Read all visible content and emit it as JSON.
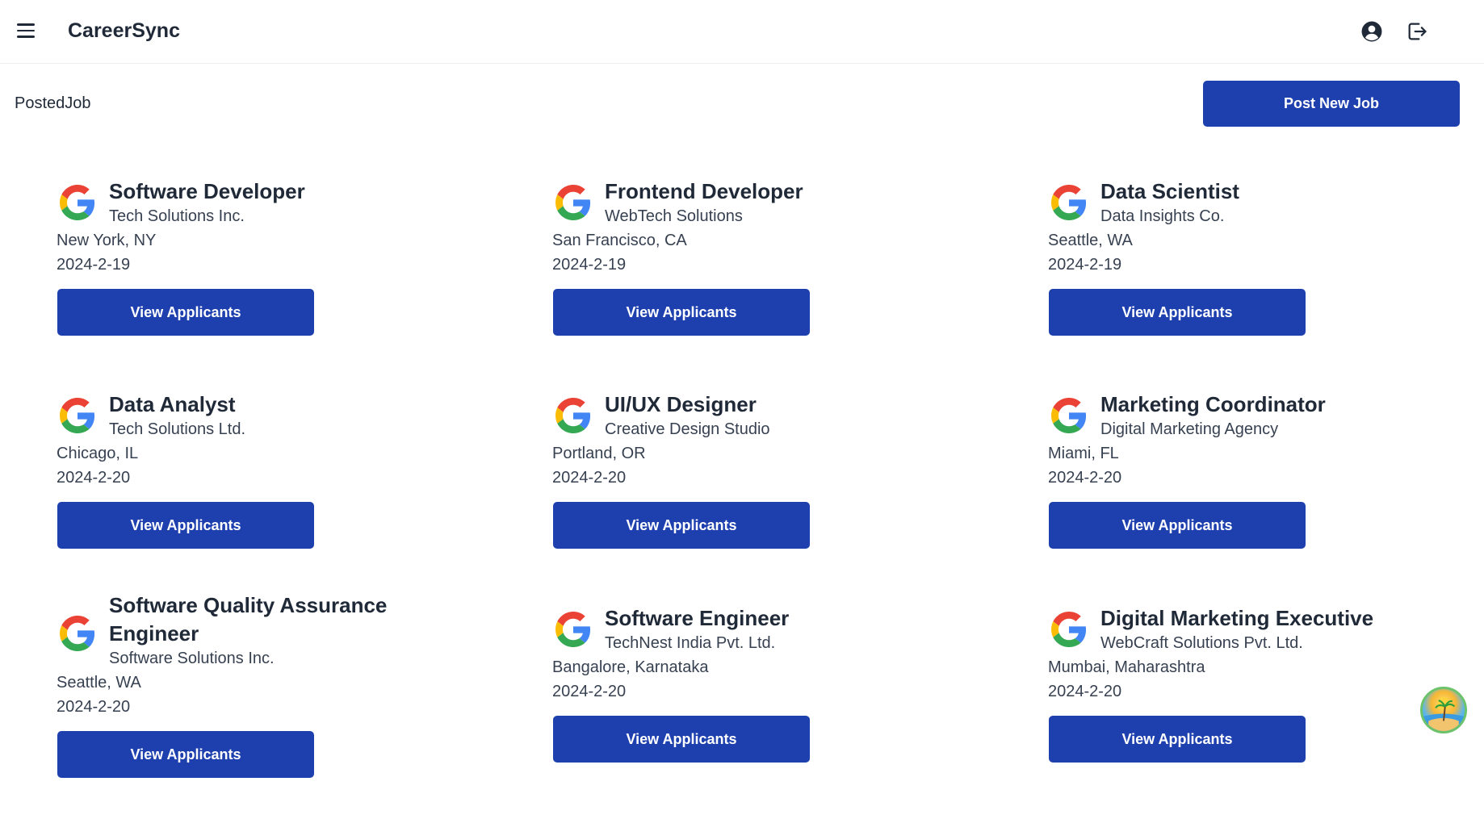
{
  "app": {
    "title": "CareerSync"
  },
  "header": {
    "menu_icon": "hamburger-menu-icon",
    "user_icon": "user-circle-icon",
    "logout_icon": "logout-icon"
  },
  "page": {
    "label": "PostedJob",
    "post_button": "Post New Job"
  },
  "colors": {
    "primary": "#1e40af",
    "text": "#1f2937"
  },
  "jobs": [
    {
      "title": "Software Developer",
      "company": "Tech Solutions Inc.",
      "location": "New York, NY",
      "date": "2024-2-19",
      "button": "View Applicants"
    },
    {
      "title": "Frontend Developer",
      "company": "WebTech Solutions",
      "location": "San Francisco, CA",
      "date": "2024-2-19",
      "button": "View Applicants"
    },
    {
      "title": "Data Scientist",
      "company": "Data Insights Co.",
      "location": "Seattle, WA",
      "date": "2024-2-19",
      "button": "View Applicants"
    },
    {
      "title": "Data Analyst",
      "company": "Tech Solutions Ltd.",
      "location": "Chicago, IL",
      "date": "2024-2-20",
      "button": "View Applicants"
    },
    {
      "title": "UI/UX Designer",
      "company": "Creative Design Studio",
      "location": "Portland, OR",
      "date": "2024-2-20",
      "button": "View Applicants"
    },
    {
      "title": "Marketing Coordinator",
      "company": "Digital Marketing Agency",
      "location": "Miami, FL",
      "date": "2024-2-20",
      "button": "View Applicants"
    },
    {
      "title": "Software Quality Assurance Engineer",
      "company": "Software Solutions Inc.",
      "location": "Seattle, WA",
      "date": "2024-2-20",
      "button": "View Applicants"
    },
    {
      "title": "Software Engineer",
      "company": "TechNest India Pvt. Ltd.",
      "location": "Bangalore, Karnataka",
      "date": "2024-2-20",
      "button": "View Applicants"
    },
    {
      "title": "Digital Marketing Executive",
      "company": "WebCraft Solutions Pvt. Ltd.",
      "location": "Mumbai, Maharashtra",
      "date": "2024-2-20",
      "button": "View Applicants"
    }
  ]
}
